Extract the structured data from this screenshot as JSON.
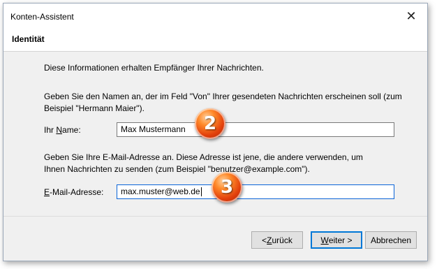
{
  "window": {
    "title": "Konten-Assistent"
  },
  "header": {
    "title": "Identität"
  },
  "content": {
    "intro": "Diese Informationen erhalten Empfänger Ihrer Nachrichten.",
    "name_help": "Geben Sie den Namen an, der im Feld \"Von\" Ihrer gesendeten Nachrichten erscheinen soll (zum Beispiel \"Hermann Maier\").",
    "name_label_pre": "Ihr ",
    "name_label_accel": "N",
    "name_label_post": "ame:",
    "name_value": "Max Mustermann",
    "email_help": "Geben Sie Ihre E-Mail-Adresse an. Diese Adresse ist jene, die andere verwenden, um Ihnen Nachrichten zu senden (zum Beispiel \"benutzer@example.com\").",
    "email_label_accel": "E",
    "email_label_post": "-Mail-Adresse:",
    "email_value": "max.muster@web.de"
  },
  "annotations": {
    "badge_name": "2",
    "badge_email": "3"
  },
  "buttons": {
    "back_pre": "< ",
    "back_accel": "Z",
    "back_post": "urück",
    "next_accel": "W",
    "next_post": "eiter >",
    "cancel": "Abbrechen"
  },
  "colors": {
    "focus_border": "#0a64d8",
    "badge": "#e2400c",
    "default_button_border": "#0078d7"
  }
}
